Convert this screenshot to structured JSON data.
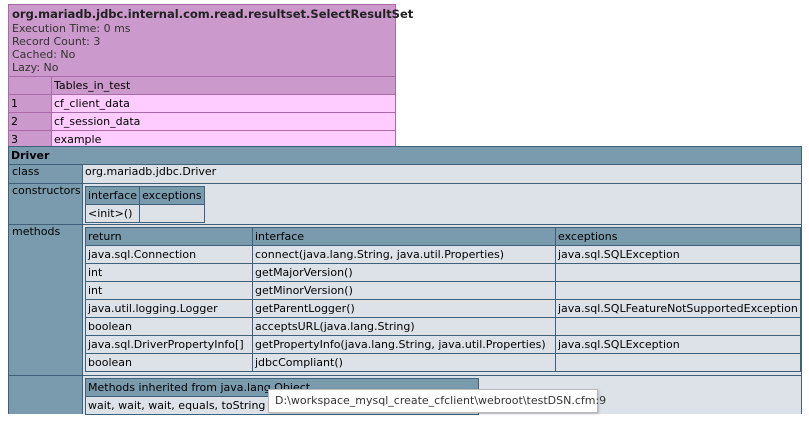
{
  "query": {
    "title": "org.mariadb.jdbc.internal.com.read.resultset.SelectResultSet",
    "meta": [
      "Execution Time: 0 ms",
      "Record Count: 3",
      "Cached: No",
      "Lazy: No"
    ],
    "column": "Tables_in_test",
    "rows": [
      {
        "idx": "1",
        "value": "cf_client_data"
      },
      {
        "idx": "2",
        "value": "cf_session_data"
      },
      {
        "idx": "3",
        "value": "example"
      }
    ]
  },
  "driver": {
    "title": "Driver",
    "class_key": "class",
    "class_value": "org.mariadb.jdbc.Driver",
    "constructors_key": "constructors",
    "constructors": {
      "headers": [
        "interface",
        "exceptions"
      ],
      "rows": [
        [
          "<init>()",
          ""
        ]
      ]
    },
    "methods_key": "methods",
    "methods": {
      "headers": [
        "return",
        "interface",
        "exceptions"
      ],
      "rows": [
        [
          "java.sql.Connection",
          "connect(java.lang.String, java.util.Properties)",
          "java.sql.SQLException"
        ],
        [
          "int",
          "getMajorVersion()",
          ""
        ],
        [
          "int",
          "getMinorVersion()",
          ""
        ],
        [
          "java.util.logging.Logger",
          "getParentLogger()",
          "java.sql.SQLFeatureNotSupportedException"
        ],
        [
          "boolean",
          "acceptsURL(java.lang.String)",
          ""
        ],
        [
          "java.sql.DriverPropertyInfo[]",
          "getPropertyInfo(java.lang.String, java.util.Properties)",
          "java.sql.SQLException"
        ],
        [
          "boolean",
          "jdbcCompliant()",
          ""
        ]
      ]
    },
    "inherited_header": "Methods inherited from java.lang.Object",
    "inherited_value": "wait, wait, wait, equals, toString"
  },
  "tooltip": "D:\\workspace_mysql_create_cfclient\\webroot\\testDSN.cfm:9"
}
